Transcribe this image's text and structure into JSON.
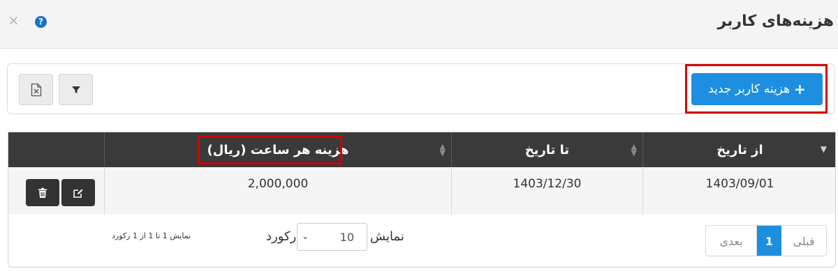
{
  "header": {
    "title": "هزینه‌های کاربر",
    "close_glyph": "×",
    "help_glyph": "?"
  },
  "toolbar": {
    "new_label": "هزینه کاربر جدید",
    "plus_glyph": "+"
  },
  "table": {
    "columns": [
      "از تاریخ",
      "تا تاریخ",
      "هزینه هر ساعت (ریال)",
      ""
    ],
    "rows": [
      {
        "from": "1403/09/01",
        "to": "1403/12/30",
        "cost": "2,000,000"
      }
    ]
  },
  "footer": {
    "prev_label": "قبلی",
    "current_page": "1",
    "next_label": "بعدی",
    "length_label": "نمایش",
    "length_value": "10",
    "length_unit": "رکورد",
    "info": "نمایش 1 تا 1 از 1 رکورد"
  },
  "colors": {
    "primary": "#1e8fe0",
    "table_header": "#3a3a3a",
    "highlight": "#d40000"
  }
}
